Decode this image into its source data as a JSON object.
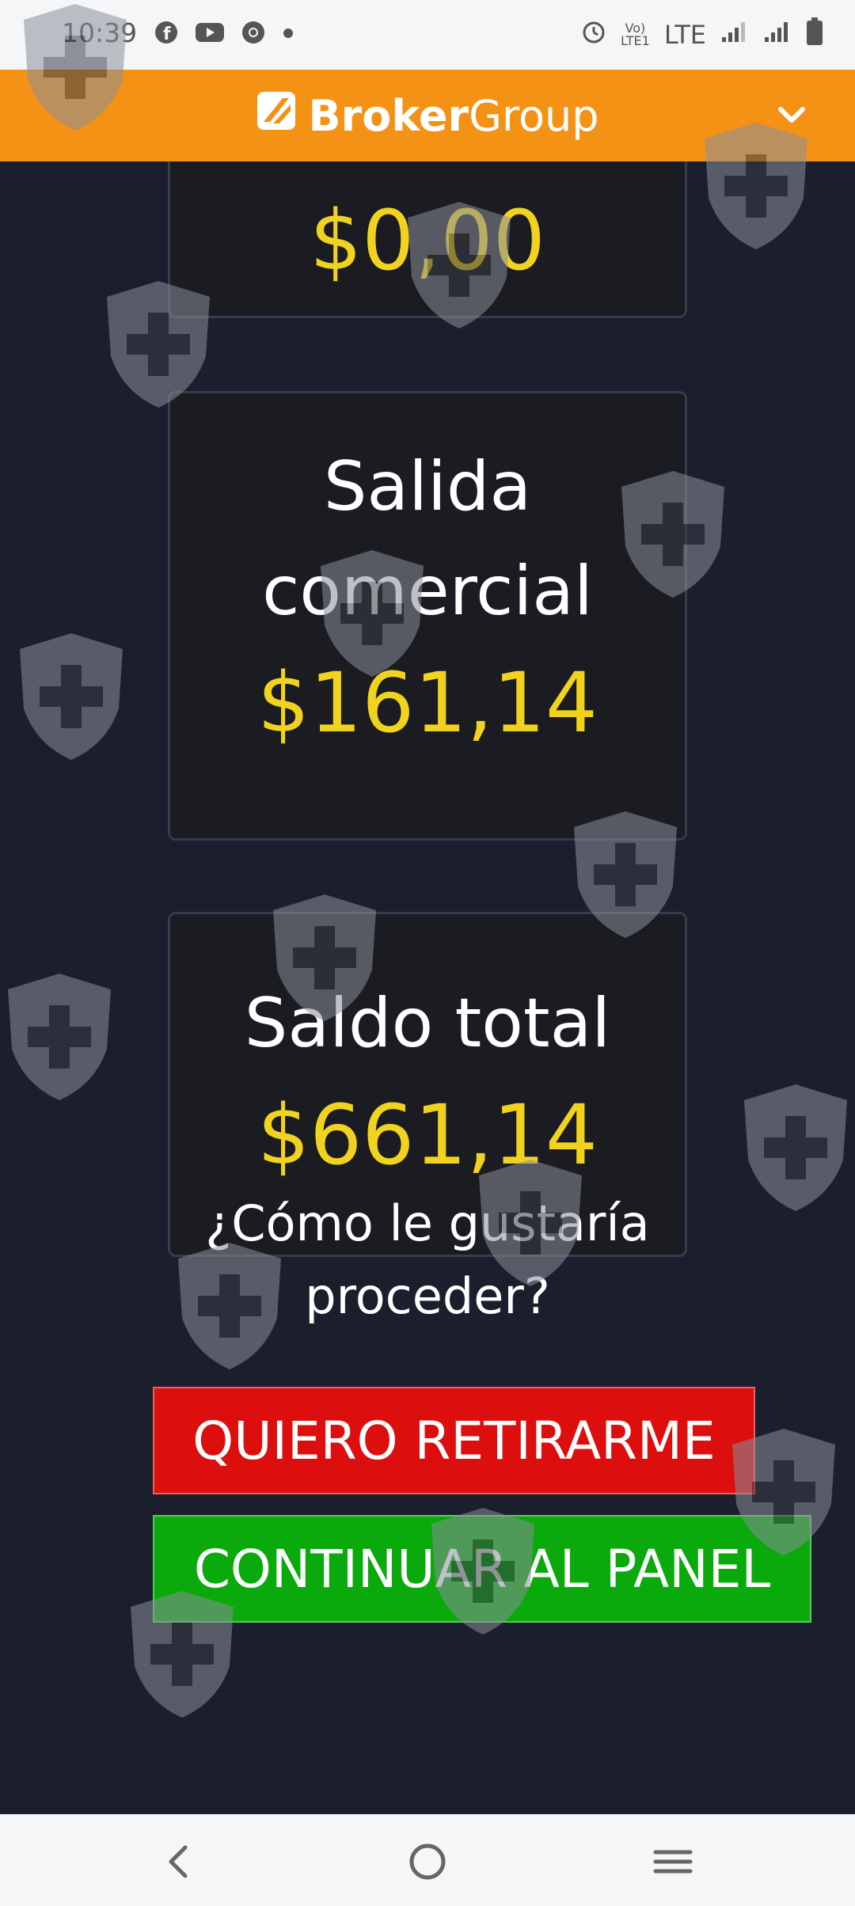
{
  "status_bar": {
    "time": "10:39",
    "left_icons": [
      "facebook-icon",
      "youtube-icon",
      "chrome-icon",
      "dot-icon"
    ],
    "right_icons": [
      "alarm-icon",
      "volte-icon",
      "signal-icon",
      "signal-icon",
      "battery-icon"
    ],
    "network": "LTE"
  },
  "app_bar": {
    "brand_bold": "Broker",
    "brand_light": "Group",
    "menu_icon": "chevron-down-icon",
    "color": "#f49216"
  },
  "cards": [
    {
      "label": "",
      "amount": "$0,00"
    },
    {
      "label_line1": "Salida",
      "label_line2": "comercial",
      "amount": "$161,14"
    },
    {
      "label": "Saldo total",
      "amount": "$661,14"
    }
  ],
  "prompt": {
    "line1": "¿Cómo le gustaría",
    "line2": "proceder?"
  },
  "buttons": {
    "withdraw": "QUIERO RETIRARME",
    "continue": "CONTINUAR AL PANEL"
  },
  "colors": {
    "amount": "#f1d21f",
    "withdraw_button": "#dd0e0e",
    "continue_button": "#0aa90c",
    "background": "#1b1e2c"
  },
  "nav_bar": {
    "icons": [
      "back-icon",
      "home-icon",
      "recents-icon"
    ]
  }
}
